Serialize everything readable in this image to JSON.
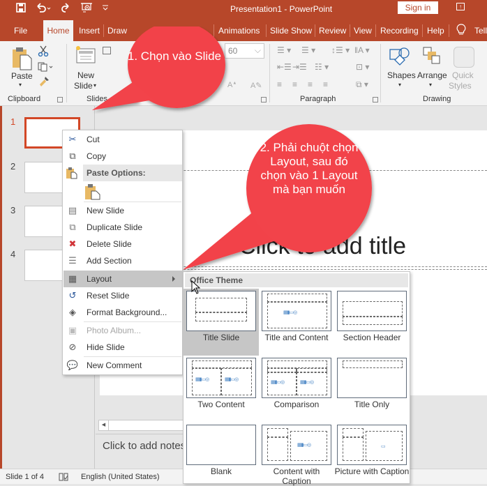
{
  "titlebar": {
    "title": "Presentation1  -  PowerPoint",
    "sign_in": "Sign in",
    "quick_access": [
      "save-icon",
      "undo-icon",
      "redo-icon",
      "start-from-beginning-icon",
      "customize-qat-icon"
    ]
  },
  "tabs": [
    {
      "label": "File"
    },
    {
      "label": "Home",
      "active": true
    },
    {
      "label": "Insert"
    },
    {
      "label": "Draw"
    },
    {
      "label": "Animations"
    },
    {
      "label": "Slide Show"
    },
    {
      "label": "Review"
    },
    {
      "label": "View"
    },
    {
      "label": "Recording"
    },
    {
      "label": "Help"
    },
    {
      "label": "Tell me"
    }
  ],
  "ribbon": {
    "clipboard": {
      "label": "Clipboard",
      "paste": "Paste"
    },
    "slides": {
      "label": "Slides",
      "new_slide_line1": "New",
      "new_slide_line2": "Slide"
    },
    "font": {
      "size": "60"
    },
    "paragraph": {
      "label": "Paragraph"
    },
    "drawing": {
      "label": "Drawing",
      "shapes": "Shapes",
      "arrange": "Arrange",
      "quick_styles_line1": "Quick",
      "quick_styles_line2": "Styles"
    }
  },
  "thumbnails": [
    {
      "number": "1",
      "selected": true
    },
    {
      "number": "2",
      "selected": false
    },
    {
      "number": "3",
      "selected": false
    },
    {
      "number": "4",
      "selected": false
    }
  ],
  "slide": {
    "title_placeholder": "Click to add title",
    "notes_placeholder": "Click to add notes"
  },
  "context_menu": {
    "items": [
      {
        "label": "Cut",
        "icon": "scissors-icon"
      },
      {
        "label": "Copy",
        "icon": "copy-icon"
      },
      {
        "label": "Paste Options:",
        "icon": "paste-icon",
        "header": true
      },
      {
        "label": "New Slide",
        "icon": "new-slide-icon"
      },
      {
        "label": "Duplicate Slide",
        "icon": "duplicate-slide-icon"
      },
      {
        "label": "Delete Slide",
        "icon": "delete-slide-icon"
      },
      {
        "label": "Add Section",
        "icon": "add-section-icon"
      },
      {
        "label": "Layout",
        "icon": "layout-icon",
        "highlighted": true,
        "submenu": true
      },
      {
        "label": "Reset Slide",
        "icon": "reset-slide-icon"
      },
      {
        "label": "Format Background...",
        "icon": "format-background-icon"
      },
      {
        "label": "Photo Album...",
        "icon": "photo-album-icon",
        "disabled": true
      },
      {
        "label": "Hide Slide",
        "icon": "hide-slide-icon"
      },
      {
        "label": "New Comment",
        "icon": "new-comment-icon"
      }
    ]
  },
  "layout_gallery": {
    "header": "Office Theme",
    "layouts": [
      {
        "name": "Title Slide",
        "selected": true
      },
      {
        "name": "Title and Content"
      },
      {
        "name": "Section Header"
      },
      {
        "name": "Two Content"
      },
      {
        "name": "Comparison"
      },
      {
        "name": "Title Only"
      },
      {
        "name": "Blank"
      },
      {
        "name": "Content with Caption"
      },
      {
        "name": "Picture with Caption"
      }
    ]
  },
  "callouts": {
    "step1": "1. Chọn vào Slide",
    "step2": "2. Phải chuột chọn Layout, sau đó chọn vào 1 Layout mà bạn muốn"
  },
  "statusbar": {
    "slide_counter": "Slide 1 of 4",
    "language": "English (United States)"
  },
  "colors": {
    "brand": "#b7472a",
    "callout": "#f2434a",
    "selected_thumb": "#d24726"
  }
}
